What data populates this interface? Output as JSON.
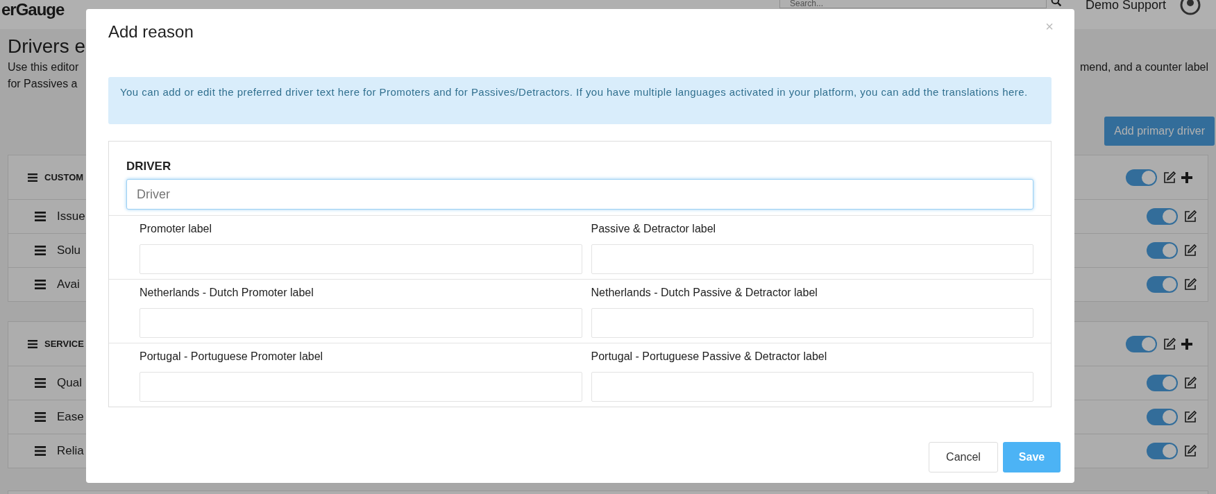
{
  "header": {
    "logo": "erGauge",
    "search": {
      "placeholder": "Search..."
    },
    "user_name": "Demo Support"
  },
  "page": {
    "title": "Drivers e",
    "description_left": [
      "Use this editor",
      "for Passives a"
    ],
    "description_right": "mend, and a counter label",
    "add_button": "Add primary driver",
    "groups": [
      {
        "name": "CUSTOM",
        "enabled": true,
        "items": [
          {
            "name": "Issue",
            "enabled": true
          },
          {
            "name": "Solu",
            "enabled": true
          },
          {
            "name": "Avai",
            "enabled": true
          }
        ]
      },
      {
        "name": "SERVICE",
        "enabled": true,
        "items": [
          {
            "name": "Qual",
            "enabled": true
          },
          {
            "name": "Ease",
            "enabled": true
          },
          {
            "name": "Relia",
            "enabled": true
          }
        ]
      }
    ]
  },
  "modal": {
    "title": "Add reason",
    "close": "×",
    "info": "You can add or edit the preferred driver text here for Promoters and for Passives/Detractors. If you have multiple languages activated in your platform, you can add the translations here.",
    "driver": {
      "label": "DRIVER",
      "placeholder": "Driver",
      "focused": true
    },
    "label_rows": [
      {
        "promoter": "Promoter label",
        "detractor": "Passive & Detractor label"
      },
      {
        "promoter": "Netherlands - Dutch Promoter label",
        "detractor": "Netherlands - Dutch Passive & Detractor label"
      },
      {
        "promoter": "Portugal - Portuguese Promoter label",
        "detractor": "Portugal - Portuguese Passive & Detractor label"
      }
    ],
    "buttons": {
      "cancel": "Cancel",
      "save": "Save"
    }
  }
}
